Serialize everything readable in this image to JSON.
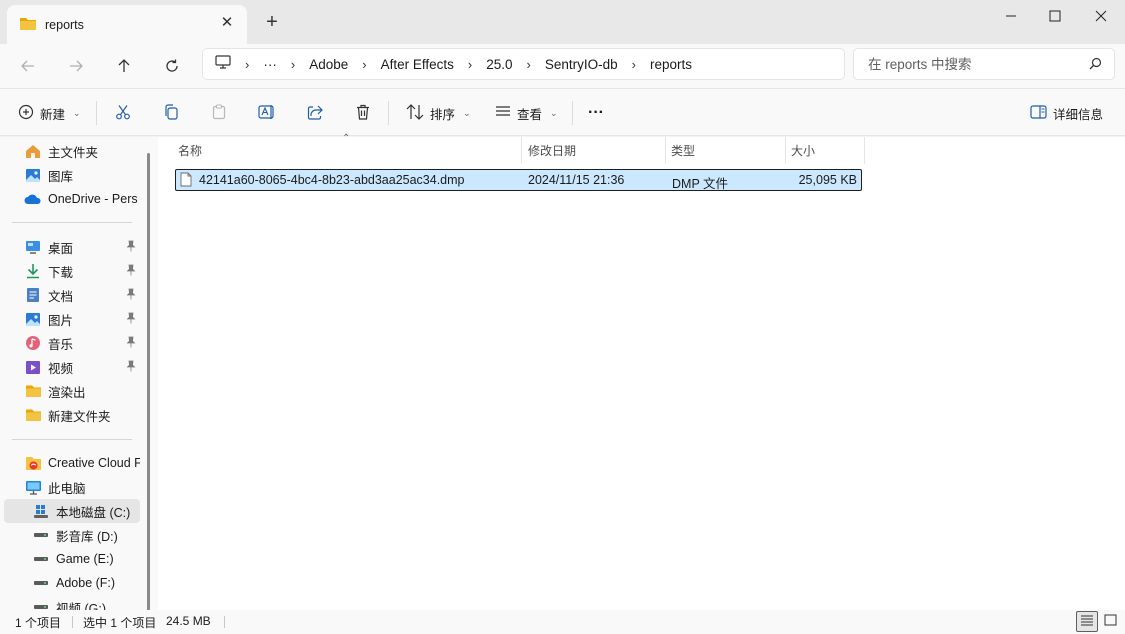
{
  "window": {
    "tab_title": "reports",
    "new_tab": "+",
    "tab_close": "✕"
  },
  "nav": {
    "breadcrumbs": [
      "Adobe",
      "After Effects",
      "25.0",
      "SentryIO-db",
      "reports"
    ],
    "overflow": "···",
    "search_placeholder": "在 reports 中搜索"
  },
  "toolbar": {
    "new_label": "新建",
    "sort_label": "排序",
    "view_label": "查看",
    "more_label": "···",
    "details_label": "详细信息"
  },
  "sidebar": {
    "quick": [
      {
        "label": "主文件夹",
        "icon": "home-icon"
      },
      {
        "label": "图库",
        "icon": "gallery-icon"
      },
      {
        "label": "OneDrive - Pers",
        "icon": "cloud-icon"
      }
    ],
    "pinned": [
      {
        "label": "桌面",
        "icon": "desktop-icon"
      },
      {
        "label": "下载",
        "icon": "download-icon"
      },
      {
        "label": "文档",
        "icon": "documents-icon"
      },
      {
        "label": "图片",
        "icon": "pictures-icon"
      },
      {
        "label": "音乐",
        "icon": "music-icon"
      },
      {
        "label": "视频",
        "icon": "videos-icon"
      },
      {
        "label": "渲染出",
        "icon": "folder-icon"
      },
      {
        "label": "新建文件夹",
        "icon": "folder-icon"
      }
    ],
    "devices": [
      {
        "label": "Creative Cloud F",
        "icon": "creative-cloud-icon"
      },
      {
        "label": "此电脑",
        "icon": "computer-icon"
      },
      {
        "label": "本地磁盘 (C:)",
        "icon": "windows-drive-icon"
      },
      {
        "label": "影音库 (D:)",
        "icon": "drive-icon"
      },
      {
        "label": "Game (E:)",
        "icon": "drive-icon"
      },
      {
        "label": "Adobe (F:)",
        "icon": "drive-icon"
      },
      {
        "label": "视频 (G:)",
        "icon": "drive-icon"
      }
    ]
  },
  "columns": {
    "name": "名称",
    "modified": "修改日期",
    "type": "类型",
    "size": "大小"
  },
  "files": [
    {
      "name": "42141a60-8065-4bc4-8b23-abd3aa25ac34.dmp",
      "modified": "2024/11/15 21:36",
      "type": "DMP 文件",
      "size": "25,095 KB"
    }
  ],
  "status": {
    "count": "1 个项目",
    "selected": "选中 1 个项目",
    "selected_size": "24.5 MB"
  },
  "colors": {
    "selection_bg": "#cce8ff",
    "folder_yellow": "#f5c342",
    "accent_blue": "#0a64c8"
  }
}
